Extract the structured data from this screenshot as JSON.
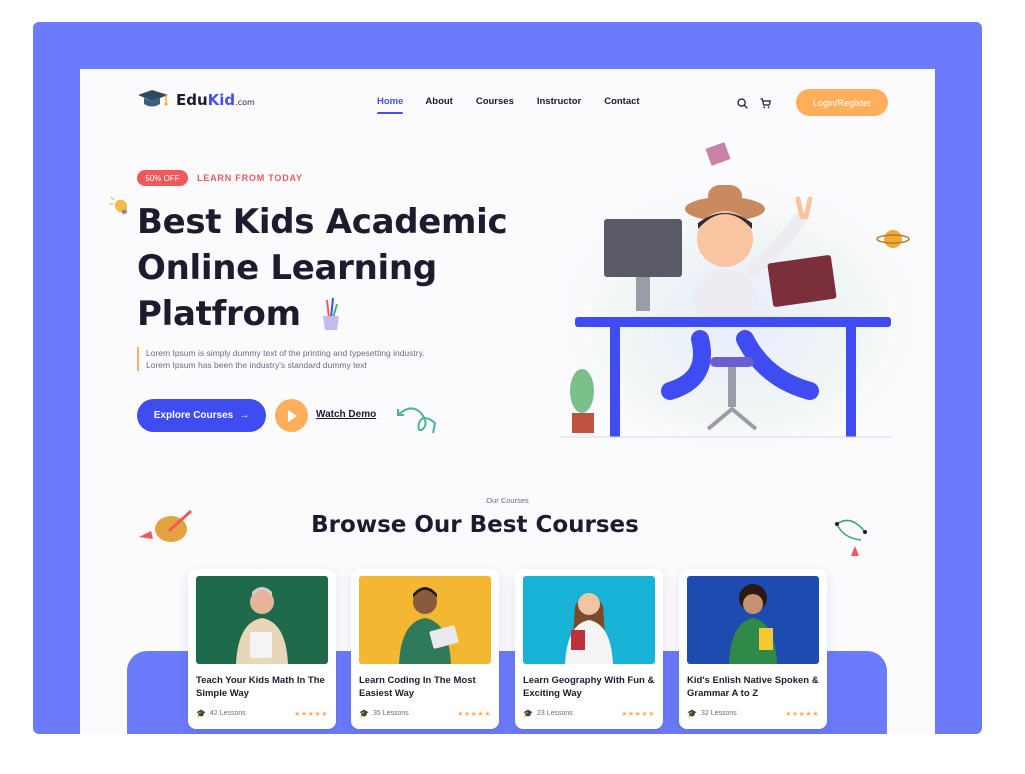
{
  "brand": {
    "name_a": "Edu",
    "name_b": "Kid",
    "suffix": ".com"
  },
  "nav": {
    "items": [
      {
        "label": "Home",
        "active": true
      },
      {
        "label": "About",
        "active": false
      },
      {
        "label": "Courses",
        "active": false
      },
      {
        "label": "Instructor",
        "active": false
      },
      {
        "label": "Contact",
        "active": false
      }
    ]
  },
  "header": {
    "search_icon": "search-icon",
    "cart_icon": "cart-icon",
    "login_label": "Login/Register"
  },
  "hero": {
    "badge": "50% OFF",
    "badge_sub": "LEARN FROM TODAY",
    "title_line1": "Best Kids Academic",
    "title_line2": "Online Learning",
    "title_line3": "Platfrom",
    "desc_line1": "Lorem Ipsum is simply dummy text of the printing and typesetting industry.",
    "desc_line2": "Lorem Ipsum has been the industry's standard dummy text",
    "explore_label": "Explore Courses",
    "watch_label": "Watch Demo"
  },
  "courses": {
    "subtitle": "Our Courses",
    "title": "Browse Our Best Courses",
    "cards": [
      {
        "title": "Teach Your Kids Math In The Simple Way",
        "lessons": "42 Lessons",
        "stars": "★★★★★",
        "bg": "#1f6a4b"
      },
      {
        "title": "Learn Coding In The Most Easiest Way",
        "lessons": "35 Lessons",
        "stars": "★★★★★",
        "bg": "#f4b731"
      },
      {
        "title": "Learn Geography With Fun & Exciting Way",
        "lessons": "23 Lessons",
        "stars": "★★★★★",
        "bg": "#17b3d6"
      },
      {
        "title": "Kid's Enlish Native Spoken & Grammar A to Z",
        "lessons": "32 Lessons",
        "stars": "★★★★★",
        "bg": "#1e4bb0"
      }
    ]
  },
  "colors": {
    "frame": "#6b7bfb",
    "accent": "#3f4cf2",
    "orange": "#ffae5c",
    "red": "#f0595a"
  }
}
